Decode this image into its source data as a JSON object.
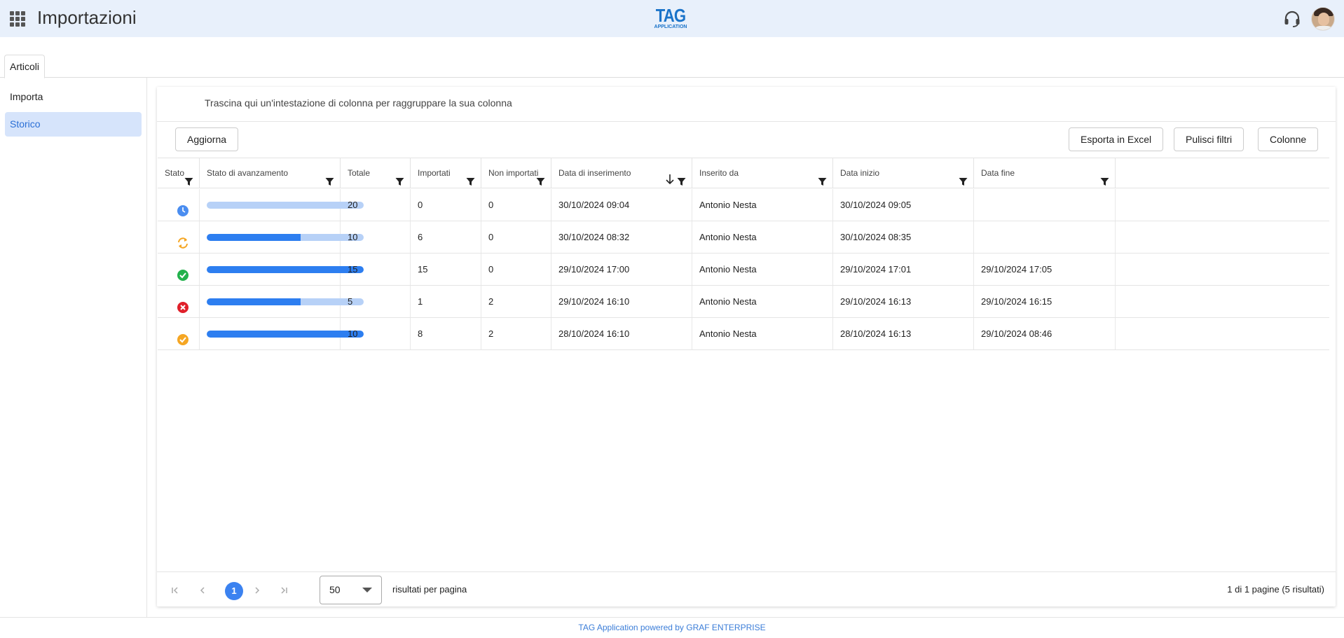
{
  "header": {
    "title": "Importazioni",
    "logo_main": "TAG",
    "logo_sub": "APPLICATION",
    "apps_icon": "apps-grid-icon",
    "support_icon": "headset-icon"
  },
  "tabs": [
    {
      "label": "Articoli",
      "active": true
    }
  ],
  "sidebar": {
    "items": [
      {
        "label": "Importa",
        "active": false
      },
      {
        "label": "Storico",
        "active": true
      }
    ]
  },
  "grid": {
    "group_hint": "Trascina qui un'intestazione di colonna per raggruppare la sua colonna",
    "toolbar": {
      "refresh": "Aggiorna",
      "export": "Esporta in Excel",
      "clear_filters": "Pulisci filtri",
      "columns": "Colonne"
    },
    "columns": [
      "Stato",
      "Stato di avanzamento",
      "Totale",
      "Importati",
      "Non importati",
      "Data di inserimento",
      "Inserito da",
      "Data inizio",
      "Data fine"
    ],
    "sorted_column": "Data di inserimento",
    "sort_direction": "descending",
    "rows": [
      {
        "status": "pending",
        "status_icon": "clock-icon",
        "progress": 0,
        "totale": "20",
        "importati": "0",
        "non_importati": "0",
        "data_inserimento": "30/10/2024 09:04",
        "inserito_da": "Antonio Nesta",
        "data_inizio": "30/10/2024 09:05",
        "data_fine": ""
      },
      {
        "status": "running",
        "status_icon": "sync-icon",
        "progress": 0.6,
        "totale": "10",
        "importati": "6",
        "non_importati": "0",
        "data_inserimento": "30/10/2024 08:32",
        "inserito_da": "Antonio Nesta",
        "data_inizio": "30/10/2024 08:35",
        "data_fine": ""
      },
      {
        "status": "success",
        "status_icon": "check-circle-icon",
        "progress": 1,
        "totale": "15",
        "importati": "15",
        "non_importati": "0",
        "data_inserimento": "29/10/2024 17:00",
        "inserito_da": "Antonio Nesta",
        "data_inizio": "29/10/2024 17:01",
        "data_fine": "29/10/2024 17:05"
      },
      {
        "status": "error",
        "status_icon": "error-circle-icon",
        "progress": 0.6,
        "totale": "5",
        "importati": "1",
        "non_importati": "2",
        "data_inserimento": "29/10/2024 16:10",
        "inserito_da": "Antonio Nesta",
        "data_inizio": "29/10/2024 16:13",
        "data_fine": "29/10/2024 16:15"
      },
      {
        "status": "warning",
        "status_icon": "check-warning-icon",
        "progress": 1,
        "totale": "10",
        "importati": "8",
        "non_importati": "2",
        "data_inserimento": "28/10/2024 16:10",
        "inserito_da": "Antonio Nesta",
        "data_inizio": "28/10/2024 16:13",
        "data_fine": "29/10/2024 08:46"
      }
    ]
  },
  "pager": {
    "current_page": "1",
    "page_size": "50",
    "page_size_label": "risultati per pagina",
    "info": "1 di 1 pagine (5 risultati)"
  },
  "footer": {
    "text": "TAG Application powered by GRAF ENTERPRISE"
  },
  "colors": {
    "accent": "#2d7ef0",
    "header_bg": "#e8f0fb",
    "sidebar_active_bg": "#d6e4fb",
    "status_pending": "#4a8df0",
    "status_running": "#f5a623",
    "status_success": "#22b14c",
    "status_error": "#e0202a",
    "status_warning": "#f5a623"
  }
}
